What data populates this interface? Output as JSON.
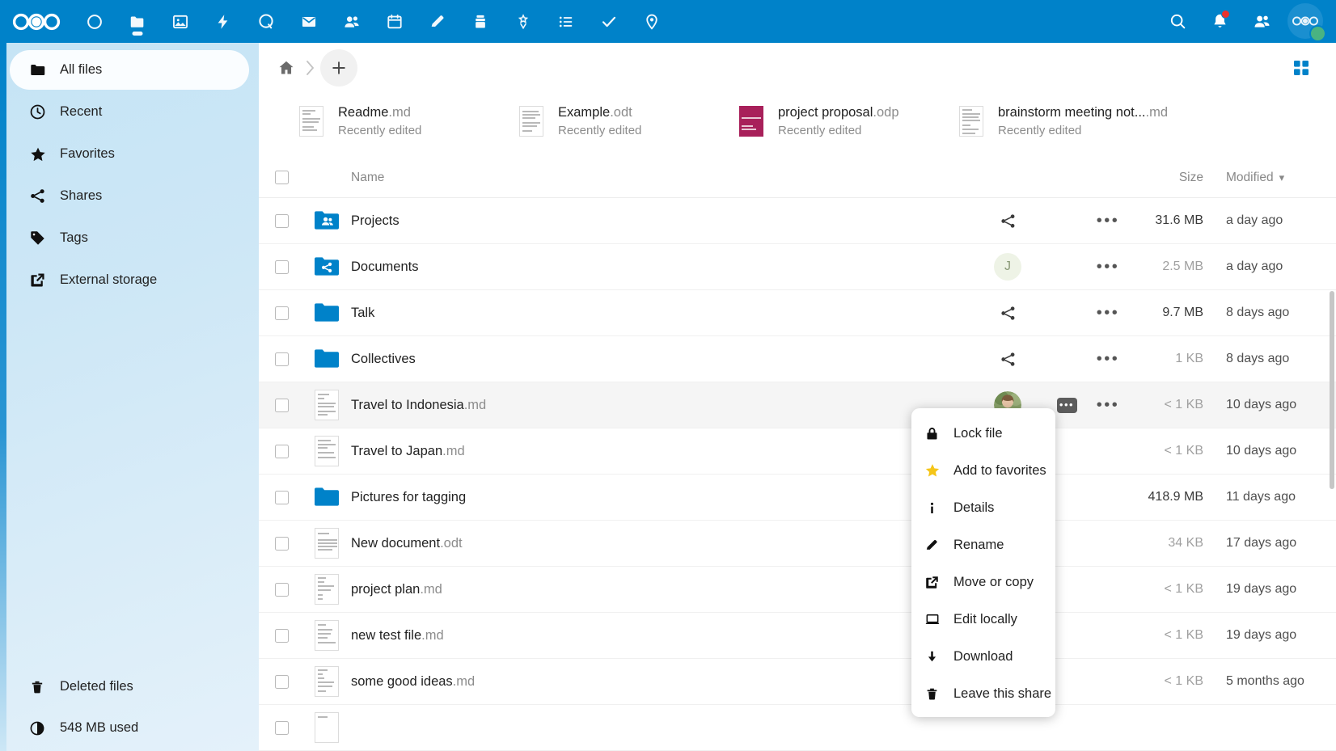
{
  "header": {
    "logo_name": "nextcloud-logo",
    "apps": [
      {
        "name": "dashboard",
        "icon": "circle-icon"
      },
      {
        "name": "files",
        "icon": "folder-icon",
        "active": true
      },
      {
        "name": "photos",
        "icon": "photos-icon"
      },
      {
        "name": "activity",
        "icon": "lightning-icon"
      },
      {
        "name": "talk",
        "icon": "talk-icon"
      },
      {
        "name": "mail",
        "icon": "mail-icon"
      },
      {
        "name": "contacts",
        "icon": "contacts-icon"
      },
      {
        "name": "calendar",
        "icon": "calendar-icon"
      },
      {
        "name": "notes",
        "icon": "pencil-icon"
      },
      {
        "name": "deck",
        "icon": "deck-icon"
      },
      {
        "name": "collectives",
        "icon": "collectives-icon"
      },
      {
        "name": "tables",
        "icon": "list-icon"
      },
      {
        "name": "tasks",
        "icon": "check-icon"
      },
      {
        "name": "maps",
        "icon": "map-pin-icon"
      }
    ],
    "right": {
      "search": "search-icon",
      "notifications": "bell-icon",
      "notifications_badge": true,
      "contacts_menu": "contacts-icon",
      "avatar": "user-avatar",
      "status": "online"
    },
    "accent_color": "#0082c9"
  },
  "sidebar": {
    "items": [
      {
        "label": "All files",
        "icon": "folder-icon",
        "active": true
      },
      {
        "label": "Recent",
        "icon": "clock-icon",
        "active": false
      },
      {
        "label": "Favorites",
        "icon": "star-icon",
        "active": false
      },
      {
        "label": "Shares",
        "icon": "share-icon",
        "active": false
      },
      {
        "label": "Tags",
        "icon": "tag-icon",
        "active": false
      },
      {
        "label": "External storage",
        "icon": "external-link-icon",
        "active": false
      }
    ],
    "footer": [
      {
        "label": "Deleted files",
        "icon": "trash-icon"
      },
      {
        "label": "548 MB used",
        "icon": "pie-chart-icon"
      }
    ]
  },
  "breadcrumb": {
    "home_icon": "home-icon",
    "separator": "›",
    "new_button_label": "+"
  },
  "toolbar": {
    "grid_view_icon": "grid-view-icon"
  },
  "recent_files": [
    {
      "name": "Readme",
      "ext": ".md",
      "subtitle": "Recently edited",
      "thumb": "md-doc"
    },
    {
      "name": "Example",
      "ext": ".odt",
      "subtitle": "Recently edited",
      "thumb": "odt-doc"
    },
    {
      "name": "project proposal",
      "ext": ".odp",
      "subtitle": "Recently edited",
      "thumb": "odp-doc"
    },
    {
      "name": "brainstorm meeting not...",
      "ext": ".md",
      "subtitle": "Recently edited",
      "thumb": "md-doc"
    }
  ],
  "table": {
    "headers": {
      "name": "Name",
      "size": "Size",
      "modified": "Modified",
      "sort_icon": "▾"
    },
    "rows": [
      {
        "name": "Projects",
        "ext": "",
        "icon": "folder-group",
        "share": "share-icon",
        "comment": null,
        "size": "31.6 MB",
        "size_strong": true,
        "modified": "a day ago",
        "highlight": false
      },
      {
        "name": "Documents",
        "ext": "",
        "icon": "folder-share",
        "share": "avatar-J",
        "avatar_initial": "J",
        "comment": null,
        "size": "2.5 MB",
        "size_strong": false,
        "modified": "a day ago",
        "highlight": false
      },
      {
        "name": "Talk",
        "ext": "",
        "icon": "folder",
        "share": "share-icon",
        "comment": null,
        "size": "9.7 MB",
        "size_strong": true,
        "modified": "8 days ago",
        "highlight": false
      },
      {
        "name": "Collectives",
        "ext": "",
        "icon": "folder",
        "share": "share-icon",
        "comment": null,
        "size": "1 KB",
        "size_strong": false,
        "modified": "8 days ago",
        "highlight": false
      },
      {
        "name": "Travel to Indonesia",
        "ext": ".md",
        "icon": "md-doc",
        "share": "avatar-photo",
        "comment": "comment-icon",
        "size": "< 1 KB",
        "size_strong": false,
        "modified": "10 days ago",
        "highlight": true
      },
      {
        "name": "Travel to Japan",
        "ext": ".md",
        "icon": "md-doc",
        "share": null,
        "comment": null,
        "size": "< 1 KB",
        "size_strong": false,
        "modified": "10 days ago",
        "highlight": false
      },
      {
        "name": "Pictures for tagging",
        "ext": "",
        "icon": "folder",
        "share": null,
        "comment": null,
        "size": "418.9 MB",
        "size_strong": true,
        "modified": "11 days ago",
        "highlight": false
      },
      {
        "name": "New document",
        "ext": ".odt",
        "icon": "odt-doc",
        "share": null,
        "comment": null,
        "size": "34 KB",
        "size_strong": false,
        "modified": "17 days ago",
        "highlight": false
      },
      {
        "name": "project plan",
        "ext": ".md",
        "icon": "md-doc",
        "share": null,
        "comment": null,
        "size": "< 1 KB",
        "size_strong": false,
        "modified": "19 days ago",
        "highlight": false
      },
      {
        "name": "new test file",
        "ext": ".md",
        "icon": "md-doc",
        "share": null,
        "comment": null,
        "size": "< 1 KB",
        "size_strong": false,
        "modified": "19 days ago",
        "highlight": false
      },
      {
        "name": "some good ideas",
        "ext": ".md",
        "icon": "md-doc",
        "share": null,
        "comment": null,
        "size": "< 1 KB",
        "size_strong": false,
        "modified": "5 months ago",
        "highlight": false
      }
    ]
  },
  "context_menu": {
    "items": [
      {
        "label": "Lock file",
        "icon": "lock-icon"
      },
      {
        "label": "Add to favorites",
        "icon": "star-icon",
        "color": "#f5c518"
      },
      {
        "label": "Details",
        "icon": "info-icon"
      },
      {
        "label": "Rename",
        "icon": "pencil-icon"
      },
      {
        "label": "Move or copy",
        "icon": "external-link-icon"
      },
      {
        "label": "Edit locally",
        "icon": "laptop-icon"
      },
      {
        "label": "Download",
        "icon": "download-icon"
      },
      {
        "label": "Leave this share",
        "icon": "trash-icon"
      }
    ]
  }
}
